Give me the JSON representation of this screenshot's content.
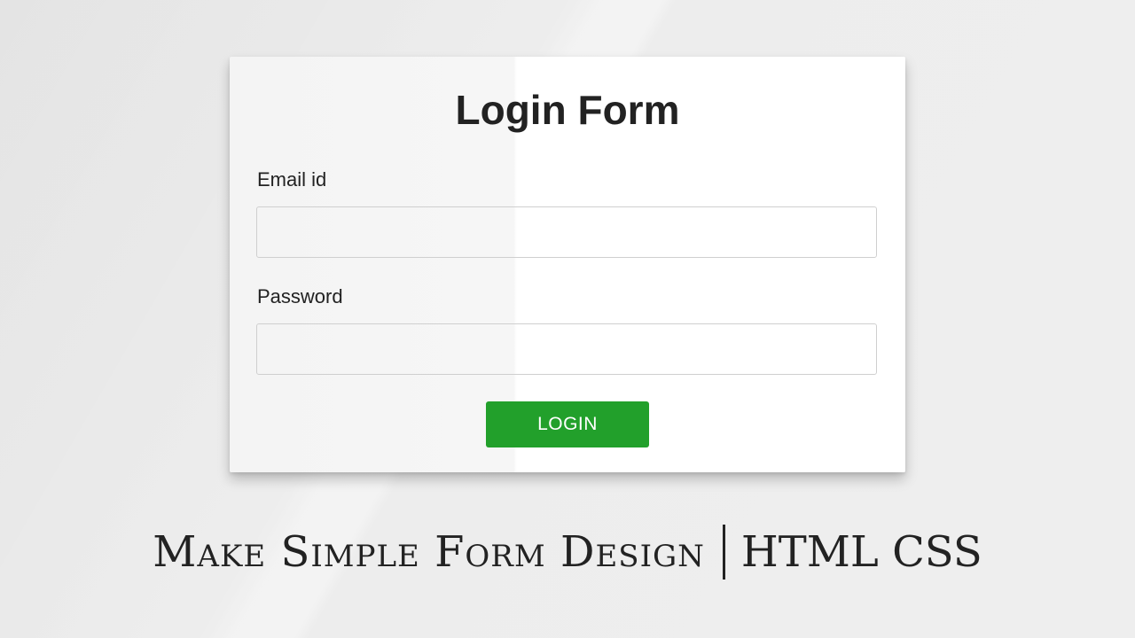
{
  "form": {
    "title": "Login Form",
    "email_label": "Email id",
    "email_value": "",
    "password_label": "Password",
    "password_value": "",
    "login_label": "LOGIN"
  },
  "caption": {
    "left_text": "Make Simple Form Design",
    "separator": "|",
    "right_text": "HTML CSS"
  },
  "colors": {
    "button": "#22a02b",
    "button_text": "#ffffff",
    "text": "#222222",
    "background": "#e8e8e8",
    "card": "#ffffff"
  }
}
